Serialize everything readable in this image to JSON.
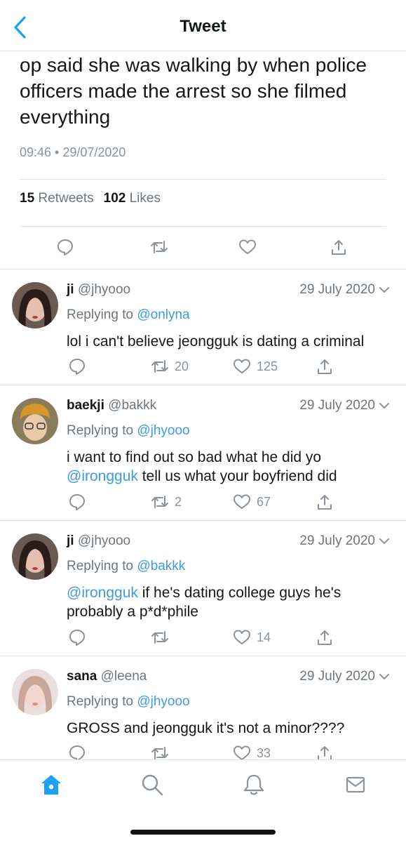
{
  "header": {
    "title": "Tweet"
  },
  "tweet": {
    "text": "op said she was walking by when police officers made the arrest so she filmed everything",
    "time": "09:46",
    "date": "29/07/2020",
    "retweets_count": "15",
    "retweets_label": "Retweets",
    "likes_count": "102",
    "likes_label": "Likes"
  },
  "replies": [
    {
      "name": "ji",
      "handle": "@jhyooo",
      "date": "29 July 2020",
      "replying_prefix": "Replying to",
      "replying_to": "@onlyna",
      "mention": "",
      "text": "lol i can't believe jeongguk is dating a criminal",
      "retweets": "20",
      "likes": "125"
    },
    {
      "name": "baekji",
      "handle": "@bakkk",
      "date": "29 July 2020",
      "replying_prefix": "Replying to",
      "replying_to": "@jhyooo",
      "mention": "@irongguk",
      "text_before": "i want to find out so bad what he did yo",
      "text": "tell us what your boyfriend did",
      "retweets": "2",
      "likes": "67"
    },
    {
      "name": "ji",
      "handle": "@jhyooo",
      "date": "29 July 2020",
      "replying_prefix": "Replying to",
      "replying_to": "@bakkk",
      "mention": "@irongguk",
      "text": "if he's dating college guys he's probably a p*d*phile",
      "retweets": "",
      "likes": "14"
    },
    {
      "name": "sana",
      "handle": "@leena",
      "date": "29 July 2020",
      "replying_prefix": "Replying to",
      "replying_to": "@jhyooo",
      "mention": "",
      "text": "GROSS and jeongguk it's not a minor????",
      "retweets": "",
      "likes": "33"
    }
  ],
  "tabbar": {
    "items": [
      "home-icon",
      "search-icon",
      "notifications-icon",
      "messages-icon"
    ],
    "active": "home-icon"
  },
  "colors": {
    "accent": "#1da1f2",
    "link": "#3d9be0",
    "muted": "#6d767d",
    "divider": "#dfe3e6"
  }
}
